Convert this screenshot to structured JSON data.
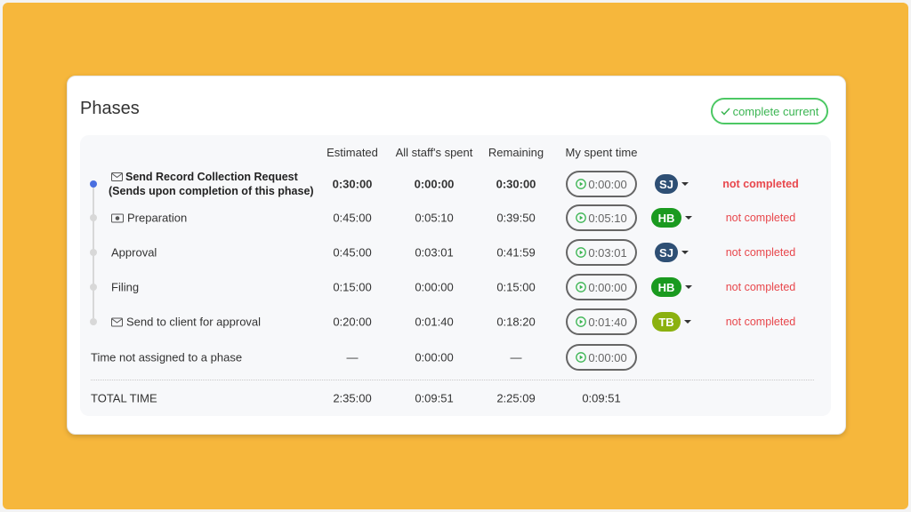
{
  "card": {
    "title": "Phases",
    "complete_button": "complete current"
  },
  "columns": {
    "estimated": "Estimated",
    "all_staff_spent": "All staff's spent",
    "remaining": "Remaining",
    "my_spent_time": "My spent time"
  },
  "phases": [
    {
      "name": "Send Record Collection Request",
      "subtitle": "(Sends upon completion of this phase)",
      "icon": "envelope-icon",
      "estimated": "0:30:00",
      "all_staff_spent": "0:00:00",
      "remaining": "0:30:00",
      "my_spent": "0:00:00",
      "assignee": "SJ",
      "assignee_color": "#2e4f74",
      "status": "not completed",
      "current": true
    },
    {
      "name": "Preparation",
      "icon": "money-icon",
      "estimated": "0:45:00",
      "all_staff_spent": "0:05:10",
      "remaining": "0:39:50",
      "my_spent": "0:05:10",
      "assignee": "HB",
      "assignee_color": "#1a9a1f",
      "status": "not completed"
    },
    {
      "name": "Approval",
      "icon": "",
      "estimated": "0:45:00",
      "all_staff_spent": "0:03:01",
      "remaining": "0:41:59",
      "my_spent": "0:03:01",
      "assignee": "SJ",
      "assignee_color": "#2e4f74",
      "status": "not completed"
    },
    {
      "name": "Filing",
      "icon": "",
      "estimated": "0:15:00",
      "all_staff_spent": "0:00:00",
      "remaining": "0:15:00",
      "my_spent": "0:00:00",
      "assignee": "HB",
      "assignee_color": "#1a9a1f",
      "status": "not completed"
    },
    {
      "name": "Send to client for approval",
      "icon": "envelope-icon",
      "estimated": "0:20:00",
      "all_staff_spent": "0:01:40",
      "remaining": "0:18:20",
      "my_spent": "0:01:40",
      "assignee": "TB",
      "assignee_color": "#8bb10f",
      "status": "not completed"
    }
  ],
  "unassigned": {
    "label": "Time not assigned to a phase",
    "estimated": "—",
    "all_staff_spent": "0:00:00",
    "remaining": "—",
    "my_spent": "0:00:00"
  },
  "total": {
    "label": "TOTAL TIME",
    "estimated": "2:35:00",
    "all_staff_spent": "0:09:51",
    "remaining": "2:25:09",
    "my_spent": "0:09:51"
  },
  "colors": {
    "background": "#f6b73c",
    "accent_green": "#3bb552",
    "status_red": "#e8474c",
    "timeline_active": "#4a6fe0"
  }
}
